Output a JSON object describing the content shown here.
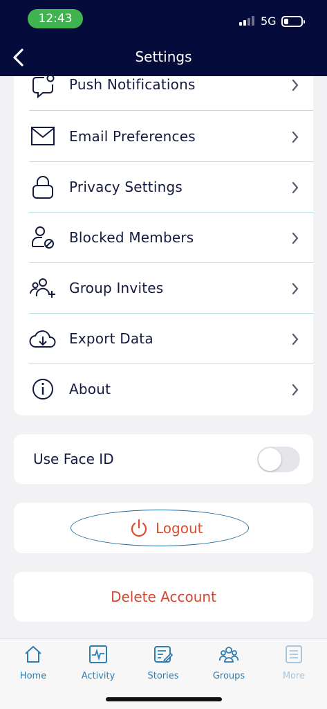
{
  "status_bar": {
    "time": "12:43",
    "network": "5G",
    "battery_level": 0.2
  },
  "header": {
    "title": "Settings"
  },
  "menu": [
    {
      "label": "Push Notifications",
      "icon": "chat-notification-icon"
    },
    {
      "label": "Email Preferences",
      "icon": "envelope-icon"
    },
    {
      "label": "Privacy Settings",
      "icon": "lock-icon"
    },
    {
      "label": "Blocked Members",
      "icon": "user-blocked-icon"
    },
    {
      "label": "Group Invites",
      "icon": "group-add-icon"
    },
    {
      "label": "Export Data",
      "icon": "cloud-download-icon"
    },
    {
      "label": "About",
      "icon": "info-icon"
    }
  ],
  "face_id": {
    "label": "Use Face ID",
    "enabled": false
  },
  "logout": {
    "label": "Logout",
    "icon": "power-icon"
  },
  "delete_account": {
    "label": "Delete Account"
  },
  "tabs": [
    {
      "label": "Home",
      "icon": "home-icon",
      "active": true
    },
    {
      "label": "Activity",
      "icon": "activity-icon",
      "active": true
    },
    {
      "label": "Stories",
      "icon": "stories-icon",
      "active": true
    },
    {
      "label": "Groups",
      "icon": "groups-icon",
      "active": true
    },
    {
      "label": "More",
      "icon": "more-icon",
      "active": false
    }
  ],
  "colors": {
    "header_bg": "#050b3b",
    "accent": "#2d7db0",
    "danger": "#e04b2c",
    "status_pill": "#3fb34f",
    "divider": "#b8dde0"
  }
}
